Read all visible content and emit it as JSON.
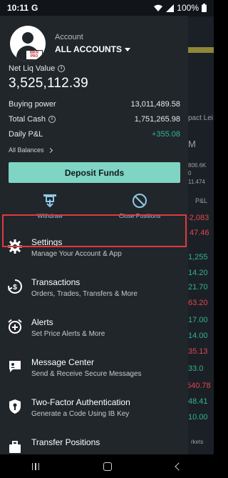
{
  "status_bar": {
    "time": "10:11",
    "g_label": "G",
    "battery": "100%"
  },
  "background": {
    "values": [
      {
        "text": "pact Lei",
        "cls": "bg-txt"
      },
      {
        "text": "M",
        "cls": "bg-txt"
      },
      {
        "text": "806.6K",
        "cls": "bg-txt"
      },
      {
        "text": "0",
        "cls": "bg-txt"
      },
      {
        "text": "11.474",
        "cls": "bg-txt"
      },
      {
        "text": "P&L",
        "cls": "bg-txt"
      },
      {
        "text": "-2,083",
        "cls": "bg-red"
      },
      {
        "text": "47.46",
        "cls": "bg-red"
      },
      {
        "text": "1,255",
        "cls": "bg-green"
      },
      {
        "text": "14.20",
        "cls": "bg-green"
      },
      {
        "text": "21.70",
        "cls": "bg-green"
      },
      {
        "text": "63.20",
        "cls": "bg-red"
      },
      {
        "text": "17.00",
        "cls": "bg-green"
      },
      {
        "text": "14.00",
        "cls": "bg-green"
      },
      {
        "text": "35.13",
        "cls": "bg-red"
      },
      {
        "text": "33.0",
        "cls": "bg-green"
      },
      {
        "text": "540.78",
        "cls": "bg-red"
      },
      {
        "text": "48.41",
        "cls": "bg-green"
      },
      {
        "text": "10.00",
        "cls": "bg-green"
      },
      {
        "text": "rkets",
        "cls": "bg-txt"
      }
    ]
  },
  "account": {
    "label": "Account",
    "name": "ALL ACCOUNTS",
    "avatar_badge": "IBKR PRO"
  },
  "net_liq": {
    "label": "Net Liq Value",
    "value": "3,525,112.39"
  },
  "balances": {
    "buying_power": {
      "label": "Buying power",
      "value": "13,011,489.58"
    },
    "total_cash": {
      "label": "Total Cash",
      "value": "1,751,265.98"
    },
    "daily_pl": {
      "label": "Daily P&L",
      "value": "+355.08"
    },
    "all_balances_link": "All Balances"
  },
  "deposit_button": "Deposit Funds",
  "quick_actions": {
    "withdraw": "Withdraw",
    "close_positions": "Close Positions"
  },
  "menu": [
    {
      "title": "Settings",
      "subtitle": "Manage Your Account & App",
      "icon": "gear-icon"
    },
    {
      "title": "Transactions",
      "subtitle": "Orders, Trades, Transfers & More",
      "icon": "transactions-icon"
    },
    {
      "title": "Alerts",
      "subtitle": "Set Price Alerts & More",
      "icon": "alarm-icon"
    },
    {
      "title": "Message Center",
      "subtitle": "Send & Receive Secure Messages",
      "icon": "message-icon"
    },
    {
      "title": "Two-Factor Authentication",
      "subtitle": "Generate a Code Using IB Key",
      "icon": "shield-key-icon"
    },
    {
      "title": "Transfer Positions",
      "subtitle": "",
      "icon": "transfer-icon"
    }
  ],
  "colors": {
    "accent_teal": "#7fd4c4",
    "positive": "#2fb591",
    "negative": "#e0474c",
    "highlight": "#e0393e"
  }
}
